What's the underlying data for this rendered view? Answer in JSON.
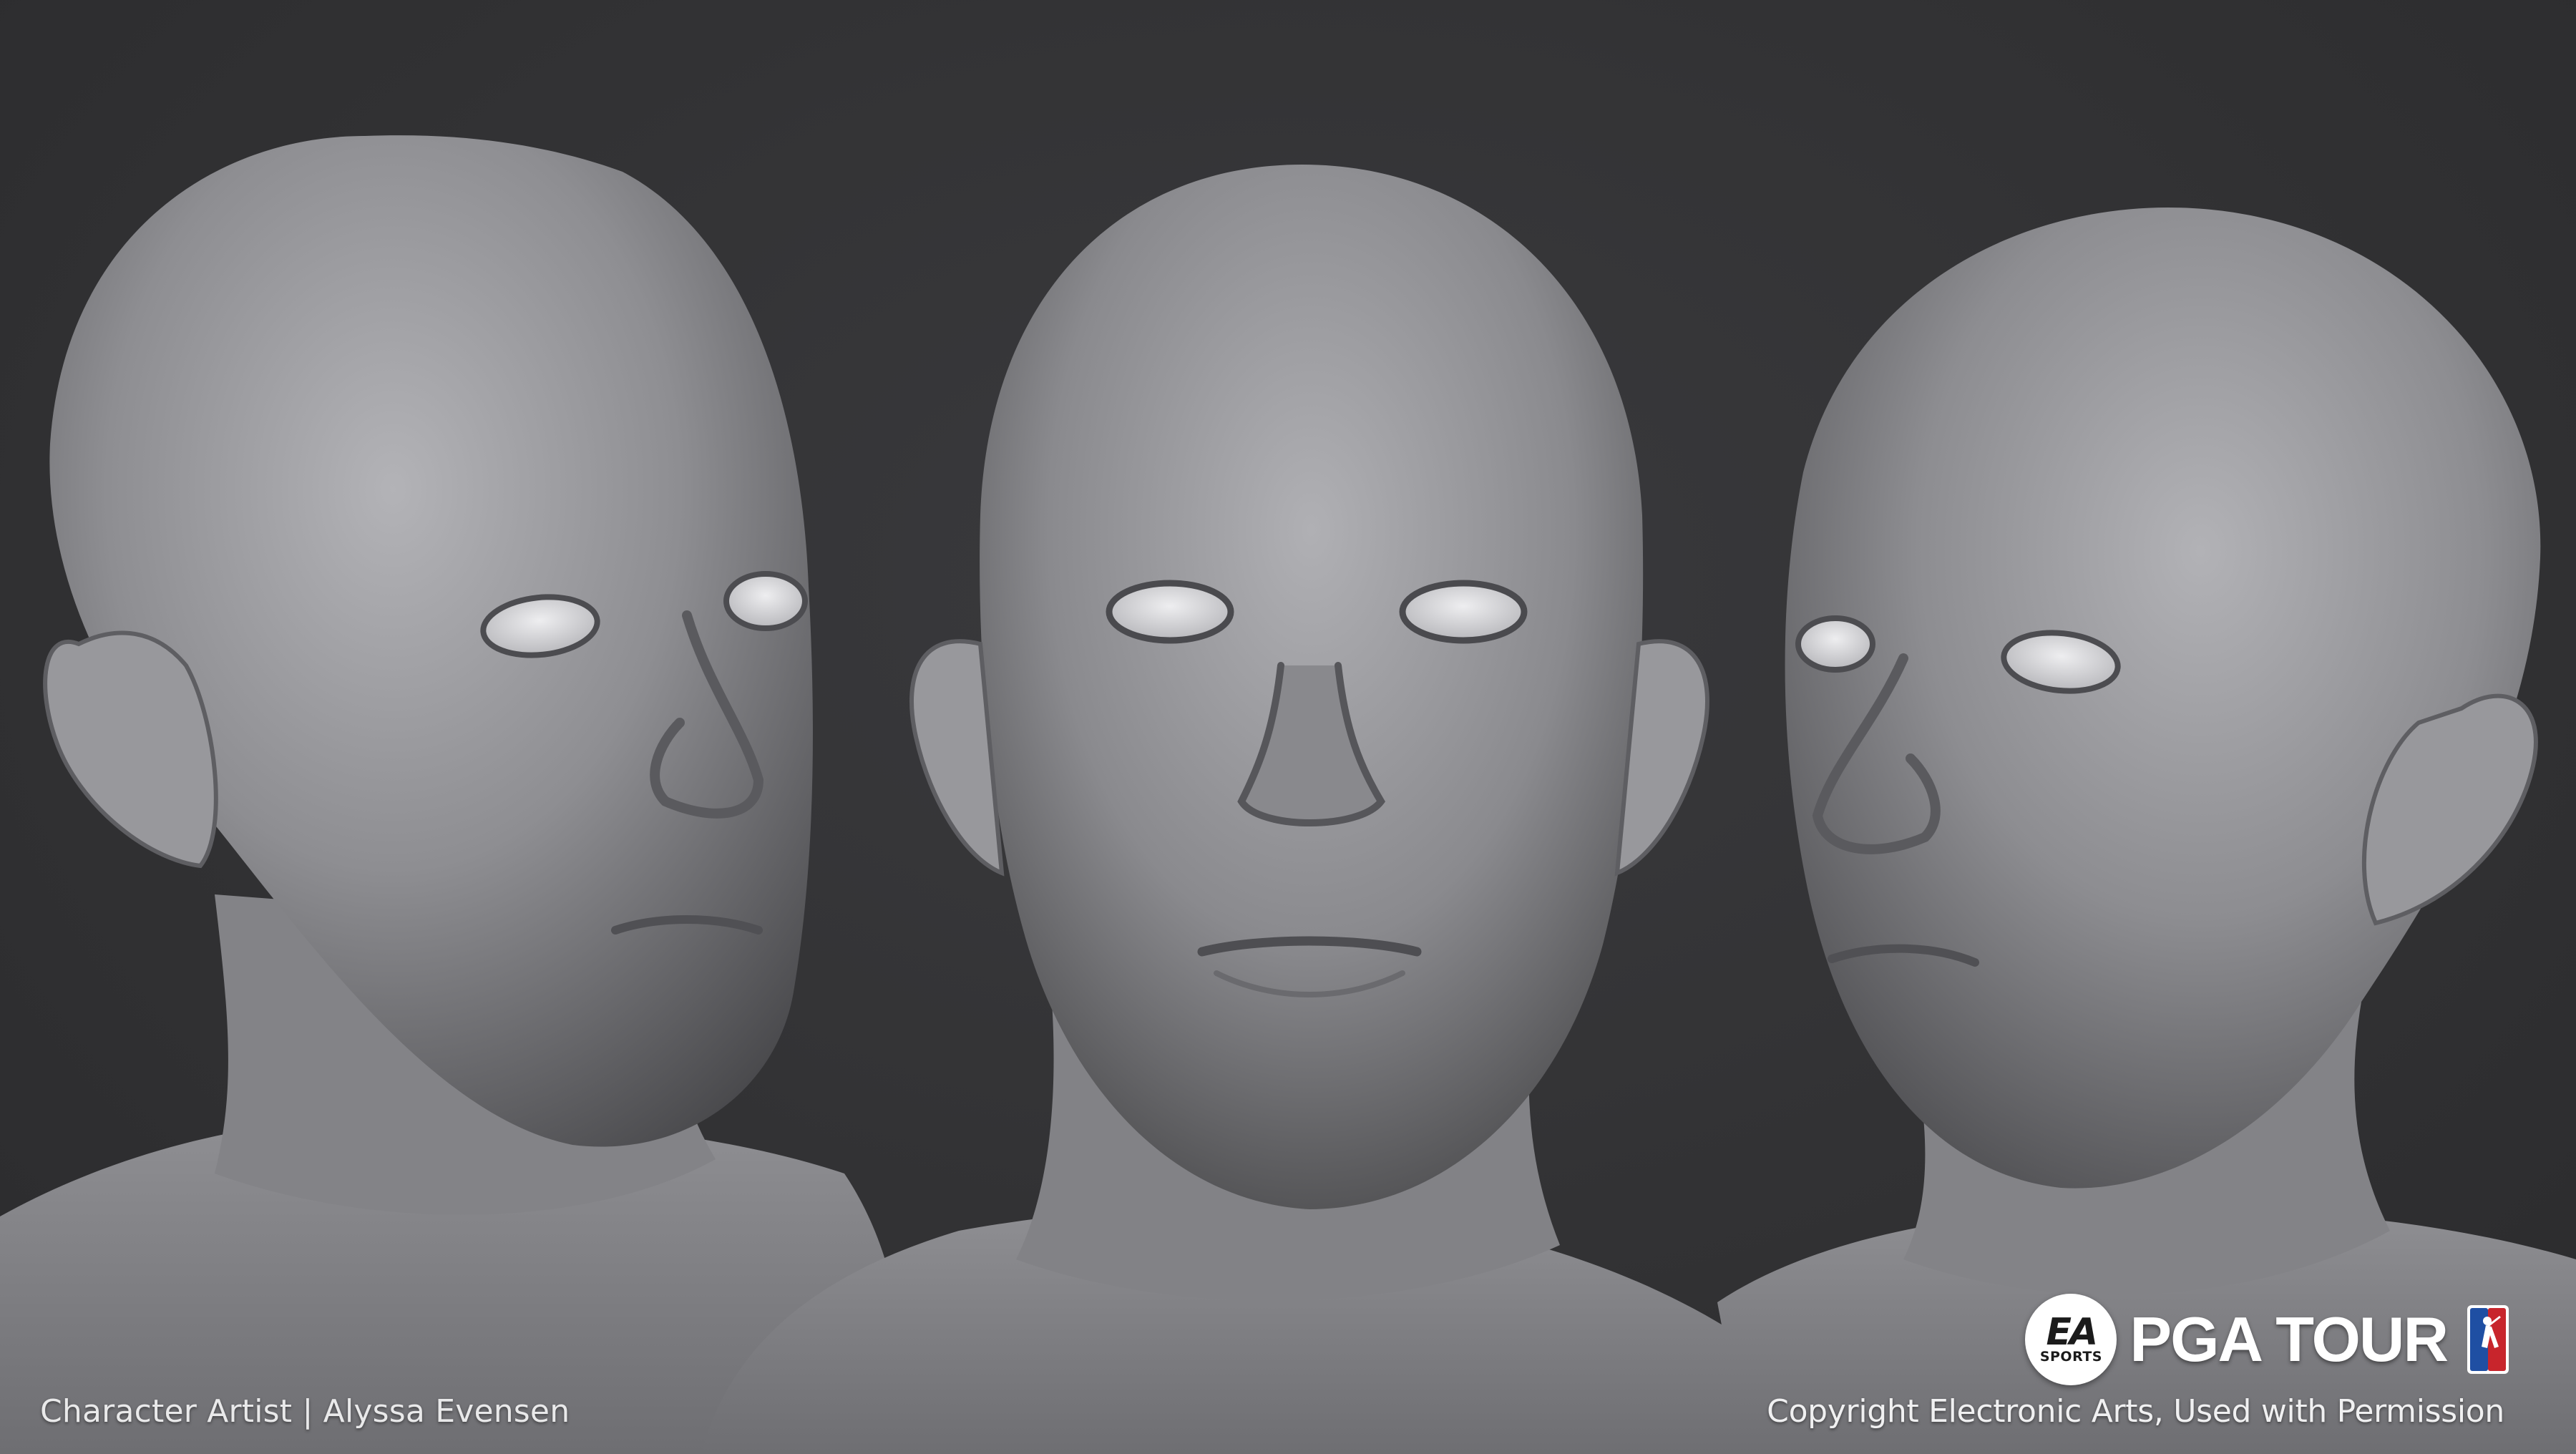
{
  "credits": {
    "artist": "Character Artist | Alyssa Evensen",
    "copyright": "Copyright Electronic Arts, Used with Permission"
  },
  "branding": {
    "ea_mark": "EA",
    "ea_sub": "SPORTS",
    "title": "PGA TOUR"
  },
  "views": [
    {
      "name": "three-quarter-left-view"
    },
    {
      "name": "front-view"
    },
    {
      "name": "three-quarter-right-view"
    }
  ],
  "colors": {
    "background": "#333335",
    "sculpt_gray": "#8c8c8f",
    "eye_white": "#e4e4e6",
    "text": "#f0f0f1",
    "pga_blue": "#1f4fa3",
    "pga_red": "#c8252c"
  },
  "icons": {
    "ea_logo": "ea-sports-logo",
    "pga_logo": "pga-tour-shield-logo"
  }
}
